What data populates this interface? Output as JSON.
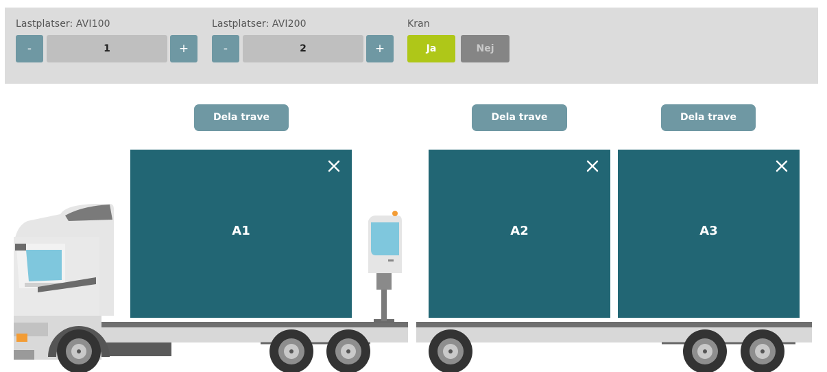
{
  "controls": {
    "avi100": {
      "label": "Lastplatser: AVI100",
      "minus": "-",
      "value": "1",
      "plus": "+"
    },
    "avi200": {
      "label": "Lastplatser: AVI200",
      "minus": "-",
      "value": "2",
      "plus": "+"
    },
    "crane": {
      "label": "Kran",
      "yes": "Ja",
      "no": "Nej",
      "selected": "Ja"
    }
  },
  "stacks": [
    {
      "name": "A1",
      "split_label": "Dela trave"
    },
    {
      "name": "A2",
      "split_label": "Dela trave"
    },
    {
      "name": "A3",
      "split_label": "Dela trave"
    }
  ],
  "icons": {
    "remove": "close-icon"
  },
  "colors": {
    "cargo": "#226674",
    "stepper": "#6f98a3",
    "crane_yes": "#afc718",
    "crane_no": "#858585",
    "panel": "#dcdcdc"
  }
}
